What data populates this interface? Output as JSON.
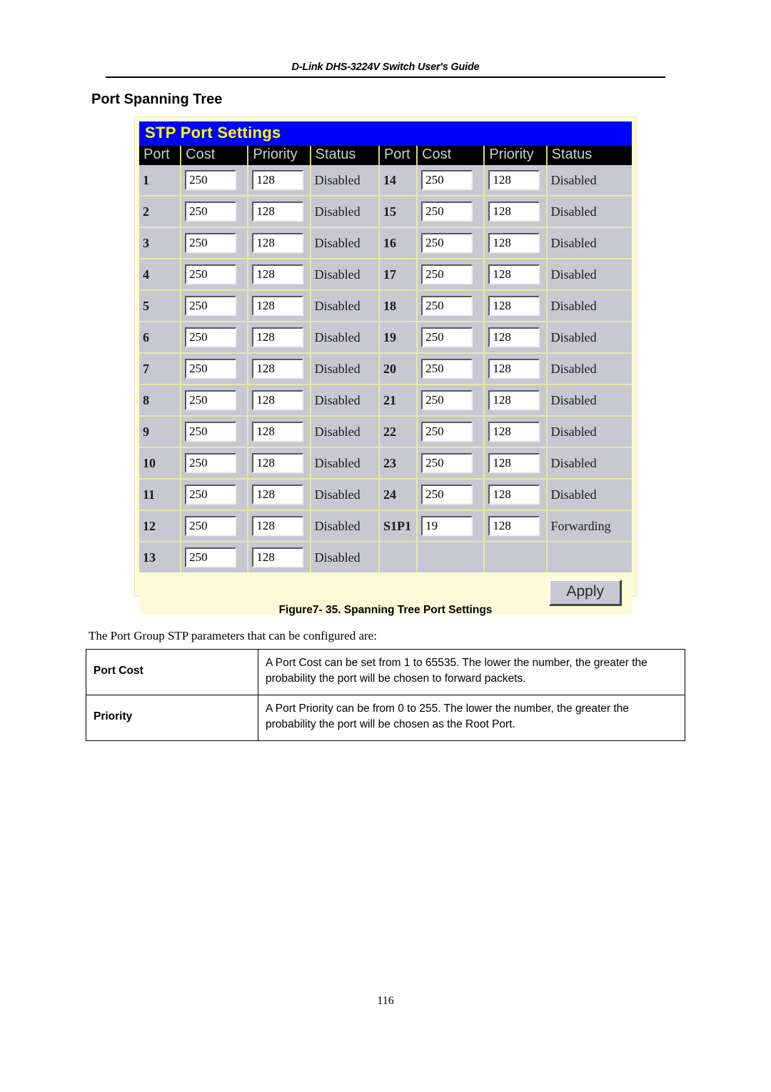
{
  "document": {
    "running_header": "D-Link DHS-3224V Switch User's Guide",
    "section_title": "Port Spanning Tree",
    "figure_caption": "Figure7- 35.  Spanning Tree Port Settings",
    "intro_paragraph": "The Port Group STP parameters that can be configured are:",
    "page_number": "116"
  },
  "stp_panel": {
    "title": "STP Port Settings",
    "apply_label": "Apply",
    "colors": {
      "titlebar_bg": "#0000ff",
      "titlebar_fg": "#ffff00",
      "header_bg": "#000000",
      "header_fg": "#cfcfcf",
      "row_bg": "#c8c8d2",
      "panel_bg": "#fbfbd8",
      "grid_line": "#e8e8a8"
    },
    "headers": [
      "Port",
      "Cost",
      "Priority",
      "Status",
      "Port",
      "Cost",
      "Priority",
      "Status"
    ],
    "rows": [
      {
        "left": {
          "port": "1",
          "cost": "250",
          "priority": "128",
          "status": "Disabled"
        },
        "right": {
          "port": "14",
          "cost": "250",
          "priority": "128",
          "status": "Disabled"
        }
      },
      {
        "left": {
          "port": "2",
          "cost": "250",
          "priority": "128",
          "status": "Disabled"
        },
        "right": {
          "port": "15",
          "cost": "250",
          "priority": "128",
          "status": "Disabled"
        }
      },
      {
        "left": {
          "port": "3",
          "cost": "250",
          "priority": "128",
          "status": "Disabled"
        },
        "right": {
          "port": "16",
          "cost": "250",
          "priority": "128",
          "status": "Disabled"
        }
      },
      {
        "left": {
          "port": "4",
          "cost": "250",
          "priority": "128",
          "status": "Disabled"
        },
        "right": {
          "port": "17",
          "cost": "250",
          "priority": "128",
          "status": "Disabled"
        }
      },
      {
        "left": {
          "port": "5",
          "cost": "250",
          "priority": "128",
          "status": "Disabled"
        },
        "right": {
          "port": "18",
          "cost": "250",
          "priority": "128",
          "status": "Disabled"
        }
      },
      {
        "left": {
          "port": "6",
          "cost": "250",
          "priority": "128",
          "status": "Disabled"
        },
        "right": {
          "port": "19",
          "cost": "250",
          "priority": "128",
          "status": "Disabled"
        }
      },
      {
        "left": {
          "port": "7",
          "cost": "250",
          "priority": "128",
          "status": "Disabled"
        },
        "right": {
          "port": "20",
          "cost": "250",
          "priority": "128",
          "status": "Disabled"
        }
      },
      {
        "left": {
          "port": "8",
          "cost": "250",
          "priority": "128",
          "status": "Disabled"
        },
        "right": {
          "port": "21",
          "cost": "250",
          "priority": "128",
          "status": "Disabled"
        }
      },
      {
        "left": {
          "port": "9",
          "cost": "250",
          "priority": "128",
          "status": "Disabled"
        },
        "right": {
          "port": "22",
          "cost": "250",
          "priority": "128",
          "status": "Disabled"
        }
      },
      {
        "left": {
          "port": "10",
          "cost": "250",
          "priority": "128",
          "status": "Disabled"
        },
        "right": {
          "port": "23",
          "cost": "250",
          "priority": "128",
          "status": "Disabled"
        }
      },
      {
        "left": {
          "port": "11",
          "cost": "250",
          "priority": "128",
          "status": "Disabled"
        },
        "right": {
          "port": "24",
          "cost": "250",
          "priority": "128",
          "status": "Disabled"
        }
      },
      {
        "left": {
          "port": "12",
          "cost": "250",
          "priority": "128",
          "status": "Disabled"
        },
        "right": {
          "port": "S1P1",
          "cost": "19",
          "priority": "128",
          "status": "Forwarding"
        }
      },
      {
        "left": {
          "port": "13",
          "cost": "250",
          "priority": "128",
          "status": "Disabled"
        },
        "right": {
          "port": "",
          "cost": null,
          "priority": null,
          "status": ""
        }
      }
    ]
  },
  "params_table": {
    "rows": [
      {
        "name": "Port Cost",
        "description": "A Port Cost can be set from 1 to 65535.  The lower the number, the greater the probability the port will be chosen to forward packets."
      },
      {
        "name": "Priority",
        "description": "A Port Priority can be from 0 to 255. The lower the number, the greater the probability the port will be chosen as the Root Port."
      }
    ]
  }
}
